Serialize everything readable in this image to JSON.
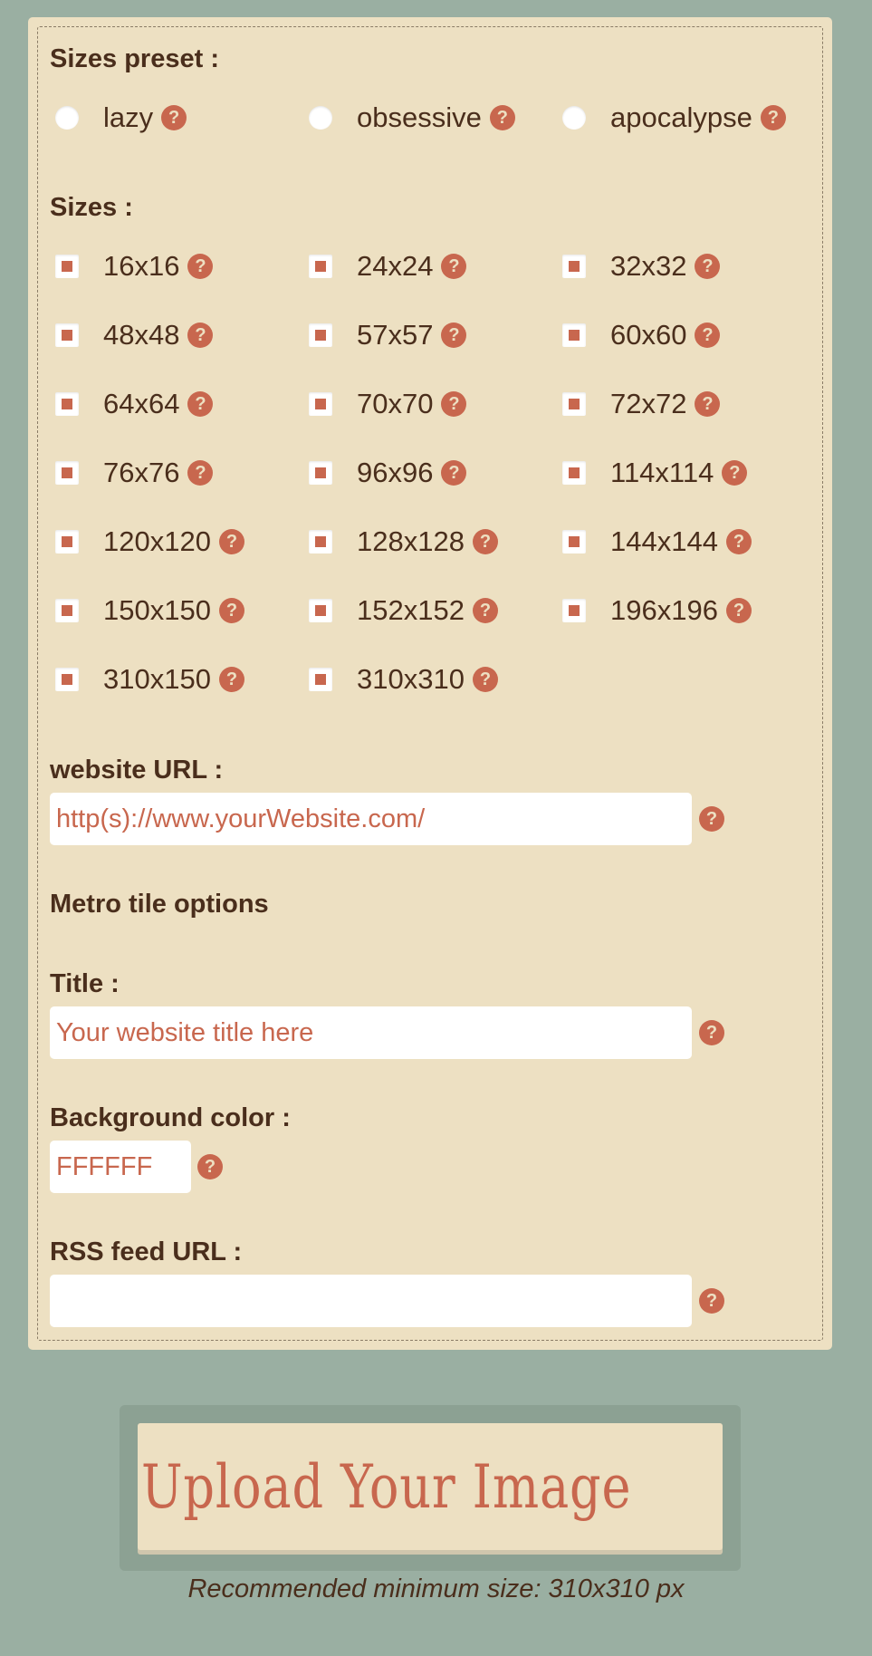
{
  "presets": {
    "label": "Sizes preset :",
    "options": [
      {
        "label": "lazy",
        "selected": false
      },
      {
        "label": "obsessive",
        "selected": false
      },
      {
        "label": "apocalypse",
        "selected": false
      }
    ]
  },
  "sizes": {
    "label": "Sizes :",
    "items": [
      {
        "label": "16x16",
        "checked": true
      },
      {
        "label": "24x24",
        "checked": true
      },
      {
        "label": "32x32",
        "checked": true
      },
      {
        "label": "48x48",
        "checked": true
      },
      {
        "label": "57x57",
        "checked": true
      },
      {
        "label": "60x60",
        "checked": true
      },
      {
        "label": "64x64",
        "checked": true
      },
      {
        "label": "70x70",
        "checked": true
      },
      {
        "label": "72x72",
        "checked": true
      },
      {
        "label": "76x76",
        "checked": true
      },
      {
        "label": "96x96",
        "checked": true
      },
      {
        "label": "114x114",
        "checked": true
      },
      {
        "label": "120x120",
        "checked": true
      },
      {
        "label": "128x128",
        "checked": true
      },
      {
        "label": "144x144",
        "checked": true
      },
      {
        "label": "150x150",
        "checked": true
      },
      {
        "label": "152x152",
        "checked": true
      },
      {
        "label": "196x196",
        "checked": true
      },
      {
        "label": "310x150",
        "checked": true
      },
      {
        "label": "310x310",
        "checked": true
      }
    ]
  },
  "website": {
    "label": "website URL :",
    "placeholder": "http(s)://www.yourWebsite.com/"
  },
  "metro": {
    "heading": "Metro tile options"
  },
  "title": {
    "label": "Title :",
    "placeholder": "Your website title here"
  },
  "bgcolor": {
    "label": "Background color :",
    "placeholder": "FFFFFF"
  },
  "rss": {
    "label": "RSS feed URL :",
    "value": ""
  },
  "help_glyph": "?",
  "upload": {
    "label": "Upload Your Image",
    "icon": "cloud-upload-icon",
    "note": "Recommended minimum size: 310x310 px"
  },
  "colors": {
    "background": "#9aafa2",
    "panel": "#ede0c2",
    "accent": "#c8674e",
    "text": "#4a2e1c"
  }
}
